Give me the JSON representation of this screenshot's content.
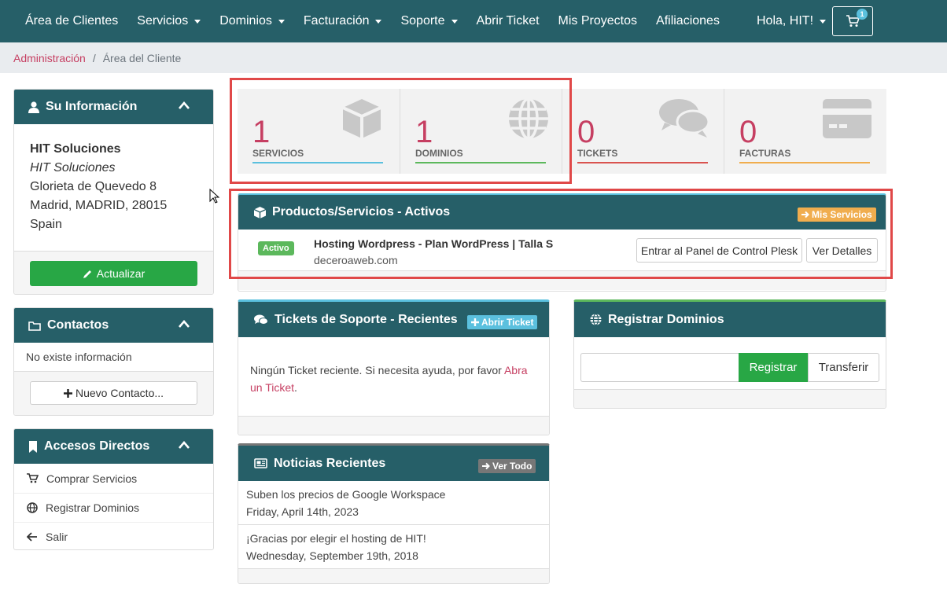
{
  "nav": {
    "items": [
      {
        "label": "Área de Clientes",
        "dropdown": false
      },
      {
        "label": "Servicios",
        "dropdown": true
      },
      {
        "label": "Dominios",
        "dropdown": true
      },
      {
        "label": "Facturación",
        "dropdown": true
      },
      {
        "label": "Soporte",
        "dropdown": true
      },
      {
        "label": "Abrir Ticket",
        "dropdown": false
      },
      {
        "label": "Mis Proyectos",
        "dropdown": false
      },
      {
        "label": "Afiliaciones",
        "dropdown": false
      }
    ],
    "greeting": "Hola, HIT!",
    "cart_count": "1"
  },
  "breadcrumb": {
    "link": "Administración",
    "separator": "/",
    "current": "Área del Cliente"
  },
  "info_panel": {
    "title": "Su Información",
    "company": "HIT Soluciones",
    "company_alt": "HIT Soluciones",
    "address1": "Glorieta de Quevedo 8",
    "address2": "Madrid, MADRID, 28015",
    "country": "Spain",
    "update_button": "Actualizar"
  },
  "contacts_panel": {
    "title": "Contactos",
    "empty_text": "No existe información",
    "new_button": "Nuevo Contacto..."
  },
  "shortcuts_panel": {
    "title": "Accesos Directos",
    "items": [
      "Comprar Servicios",
      "Registrar Dominios",
      "Salir"
    ]
  },
  "tiles": [
    {
      "value": "1",
      "label": "SERVICIOS",
      "color": "#5bc0de",
      "icon": "cube-icon"
    },
    {
      "value": "1",
      "label": "DOMINIOS",
      "color": "#5cb85c",
      "icon": "globe-icon"
    },
    {
      "value": "0",
      "label": "TICKETS",
      "color": "#d9534f",
      "icon": "comments-icon"
    },
    {
      "value": "0",
      "label": "FACTURAS",
      "color": "#f0ad4e",
      "icon": "credit-card-icon"
    }
  ],
  "products": {
    "title": "Productos/Servicios - Activos",
    "header_button": "Mis Servicios",
    "status": "Activo",
    "product_name": "Hosting Wordpress - Plan WordPress | Talla S",
    "domain": "deceroaweb.com",
    "panel_button": "Entrar al Panel de Control Plesk",
    "details_button": "Ver Detalles"
  },
  "tickets": {
    "title": "Tickets de Soporte - Recientes",
    "header_button": "Abrir Ticket",
    "text": "Ningún Ticket reciente. Si necesita ayuda, por favor",
    "link_line1": "Abra",
    "link_line2": "un Ticket",
    "suffix": "."
  },
  "domains": {
    "title": "Registrar Dominios",
    "register_button": "Registrar",
    "transfer_button": "Transferir",
    "input_value": ""
  },
  "news": {
    "title": "Noticias Recientes",
    "header_button": "Ver Todo",
    "items": [
      {
        "title": "Suben los precios de Google Workspace",
        "date": "Friday, April 14th, 2023"
      },
      {
        "title": "¡Gracias por elegir el hosting de HIT!",
        "date": "Wednesday, September 19th, 2018"
      }
    ]
  },
  "colors": {
    "header": "#265f68",
    "accent": "#c63f62",
    "success": "#28a745",
    "warning": "#f0ad4e",
    "info": "#5bc0de",
    "highlight": "#e04848"
  }
}
